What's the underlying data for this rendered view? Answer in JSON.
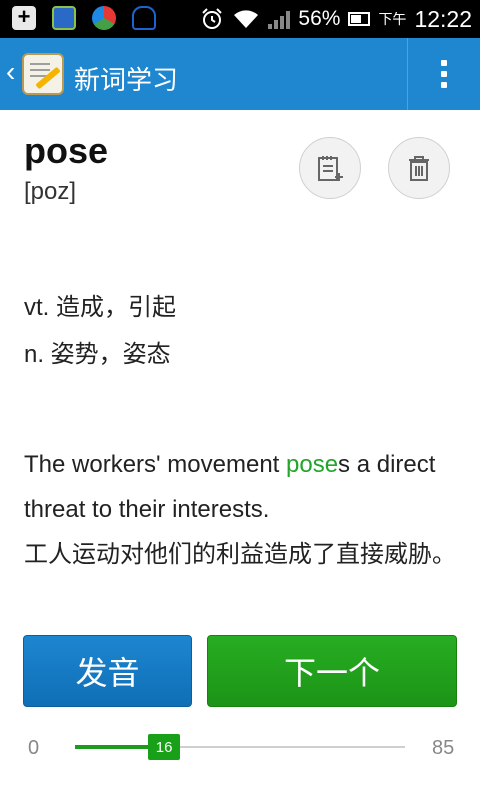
{
  "status_bar": {
    "battery": "56%",
    "time_prefix": "下午",
    "time": "12:22"
  },
  "action_bar": {
    "title": "新词学习"
  },
  "word": {
    "text": "pose",
    "phonetic": "[poz]"
  },
  "definitions": [
    "vt. 造成，引起",
    "n. 姿势，姿态"
  ],
  "example": {
    "before": "The workers' movement ",
    "highlight": "pose",
    "after": "s a direct threat to their interests.",
    "translation": "工人运动对他们的利益造成了直接威胁。"
  },
  "buttons": {
    "speak_label": "发音",
    "next_label": "下一个"
  },
  "progress": {
    "min": "0",
    "max": "85",
    "current": "16",
    "value": 16,
    "total": 85
  },
  "colors": {
    "action_bar": "#1f87d0",
    "accent_green": "#22a52a",
    "button_blue": "#1d86d0",
    "button_green": "#27ad22"
  }
}
